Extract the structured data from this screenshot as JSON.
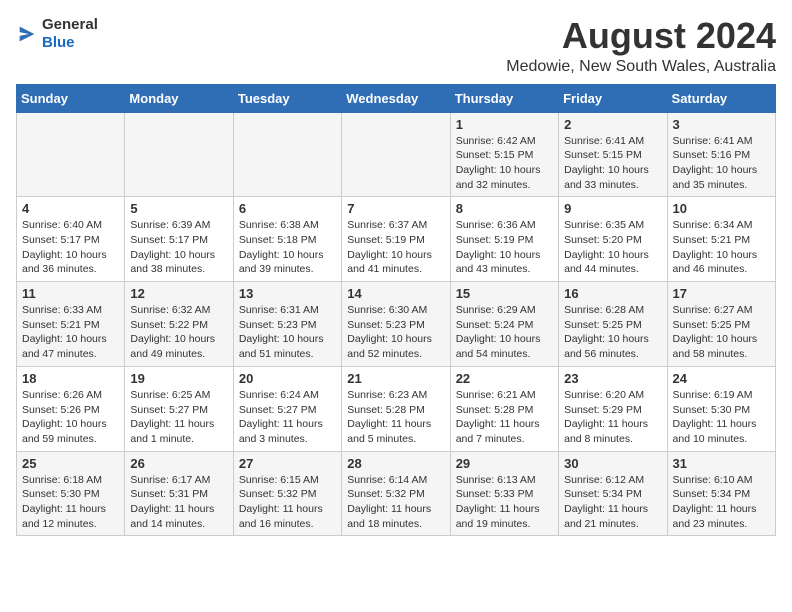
{
  "header": {
    "logo_line1": "General",
    "logo_line2": "Blue",
    "month_year": "August 2024",
    "location": "Medowie, New South Wales, Australia"
  },
  "weekdays": [
    "Sunday",
    "Monday",
    "Tuesday",
    "Wednesday",
    "Thursday",
    "Friday",
    "Saturday"
  ],
  "weeks": [
    [
      {
        "day": "",
        "info": ""
      },
      {
        "day": "",
        "info": ""
      },
      {
        "day": "",
        "info": ""
      },
      {
        "day": "",
        "info": ""
      },
      {
        "day": "1",
        "info": "Sunrise: 6:42 AM\nSunset: 5:15 PM\nDaylight: 10 hours\nand 32 minutes."
      },
      {
        "day": "2",
        "info": "Sunrise: 6:41 AM\nSunset: 5:15 PM\nDaylight: 10 hours\nand 33 minutes."
      },
      {
        "day": "3",
        "info": "Sunrise: 6:41 AM\nSunset: 5:16 PM\nDaylight: 10 hours\nand 35 minutes."
      }
    ],
    [
      {
        "day": "4",
        "info": "Sunrise: 6:40 AM\nSunset: 5:17 PM\nDaylight: 10 hours\nand 36 minutes."
      },
      {
        "day": "5",
        "info": "Sunrise: 6:39 AM\nSunset: 5:17 PM\nDaylight: 10 hours\nand 38 minutes."
      },
      {
        "day": "6",
        "info": "Sunrise: 6:38 AM\nSunset: 5:18 PM\nDaylight: 10 hours\nand 39 minutes."
      },
      {
        "day": "7",
        "info": "Sunrise: 6:37 AM\nSunset: 5:19 PM\nDaylight: 10 hours\nand 41 minutes."
      },
      {
        "day": "8",
        "info": "Sunrise: 6:36 AM\nSunset: 5:19 PM\nDaylight: 10 hours\nand 43 minutes."
      },
      {
        "day": "9",
        "info": "Sunrise: 6:35 AM\nSunset: 5:20 PM\nDaylight: 10 hours\nand 44 minutes."
      },
      {
        "day": "10",
        "info": "Sunrise: 6:34 AM\nSunset: 5:21 PM\nDaylight: 10 hours\nand 46 minutes."
      }
    ],
    [
      {
        "day": "11",
        "info": "Sunrise: 6:33 AM\nSunset: 5:21 PM\nDaylight: 10 hours\nand 47 minutes."
      },
      {
        "day": "12",
        "info": "Sunrise: 6:32 AM\nSunset: 5:22 PM\nDaylight: 10 hours\nand 49 minutes."
      },
      {
        "day": "13",
        "info": "Sunrise: 6:31 AM\nSunset: 5:23 PM\nDaylight: 10 hours\nand 51 minutes."
      },
      {
        "day": "14",
        "info": "Sunrise: 6:30 AM\nSunset: 5:23 PM\nDaylight: 10 hours\nand 52 minutes."
      },
      {
        "day": "15",
        "info": "Sunrise: 6:29 AM\nSunset: 5:24 PM\nDaylight: 10 hours\nand 54 minutes."
      },
      {
        "day": "16",
        "info": "Sunrise: 6:28 AM\nSunset: 5:25 PM\nDaylight: 10 hours\nand 56 minutes."
      },
      {
        "day": "17",
        "info": "Sunrise: 6:27 AM\nSunset: 5:25 PM\nDaylight: 10 hours\nand 58 minutes."
      }
    ],
    [
      {
        "day": "18",
        "info": "Sunrise: 6:26 AM\nSunset: 5:26 PM\nDaylight: 10 hours\nand 59 minutes."
      },
      {
        "day": "19",
        "info": "Sunrise: 6:25 AM\nSunset: 5:27 PM\nDaylight: 11 hours\nand 1 minute."
      },
      {
        "day": "20",
        "info": "Sunrise: 6:24 AM\nSunset: 5:27 PM\nDaylight: 11 hours\nand 3 minutes."
      },
      {
        "day": "21",
        "info": "Sunrise: 6:23 AM\nSunset: 5:28 PM\nDaylight: 11 hours\nand 5 minutes."
      },
      {
        "day": "22",
        "info": "Sunrise: 6:21 AM\nSunset: 5:28 PM\nDaylight: 11 hours\nand 7 minutes."
      },
      {
        "day": "23",
        "info": "Sunrise: 6:20 AM\nSunset: 5:29 PM\nDaylight: 11 hours\nand 8 minutes."
      },
      {
        "day": "24",
        "info": "Sunrise: 6:19 AM\nSunset: 5:30 PM\nDaylight: 11 hours\nand 10 minutes."
      }
    ],
    [
      {
        "day": "25",
        "info": "Sunrise: 6:18 AM\nSunset: 5:30 PM\nDaylight: 11 hours\nand 12 minutes."
      },
      {
        "day": "26",
        "info": "Sunrise: 6:17 AM\nSunset: 5:31 PM\nDaylight: 11 hours\nand 14 minutes."
      },
      {
        "day": "27",
        "info": "Sunrise: 6:15 AM\nSunset: 5:32 PM\nDaylight: 11 hours\nand 16 minutes."
      },
      {
        "day": "28",
        "info": "Sunrise: 6:14 AM\nSunset: 5:32 PM\nDaylight: 11 hours\nand 18 minutes."
      },
      {
        "day": "29",
        "info": "Sunrise: 6:13 AM\nSunset: 5:33 PM\nDaylight: 11 hours\nand 19 minutes."
      },
      {
        "day": "30",
        "info": "Sunrise: 6:12 AM\nSunset: 5:34 PM\nDaylight: 11 hours\nand 21 minutes."
      },
      {
        "day": "31",
        "info": "Sunrise: 6:10 AM\nSunset: 5:34 PM\nDaylight: 11 hours\nand 23 minutes."
      }
    ]
  ]
}
